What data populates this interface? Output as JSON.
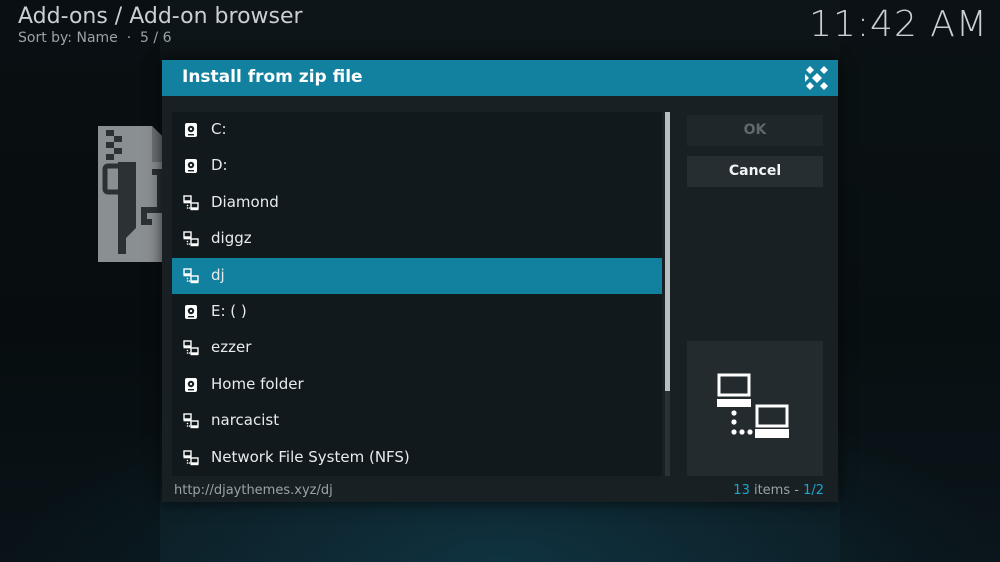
{
  "header": {
    "title": "Add-ons / Add-on browser",
    "sort_label": "Sort by: Name",
    "separator": "·",
    "position": "5 / 6",
    "clock": "11:42 AM"
  },
  "dialog": {
    "title": "Install from zip file",
    "buttons": {
      "ok": "OK",
      "cancel": "Cancel"
    },
    "items": [
      {
        "label": "C:",
        "icon": "hard-drive-icon"
      },
      {
        "label": "D:",
        "icon": "hard-drive-icon"
      },
      {
        "label": "Diamond",
        "icon": "network-icon"
      },
      {
        "label": "diggz",
        "icon": "network-icon"
      },
      {
        "label": "dj",
        "icon": "network-icon",
        "selected": true
      },
      {
        "label": "E: ( )",
        "icon": "hard-drive-icon"
      },
      {
        "label": "ezzer",
        "icon": "network-icon"
      },
      {
        "label": "Home folder",
        "icon": "hard-drive-icon"
      },
      {
        "label": "narcacist",
        "icon": "network-icon"
      },
      {
        "label": "Network File System (NFS)",
        "icon": "network-icon"
      }
    ],
    "footer": {
      "path": "http://djaythemes.xyz/dj",
      "count": "13",
      "count_label": " items - ",
      "page": "1/2"
    }
  },
  "colors": {
    "accent": "#12809f",
    "accent_text": "#1ba6cc",
    "dialog_bg": "#192024"
  }
}
